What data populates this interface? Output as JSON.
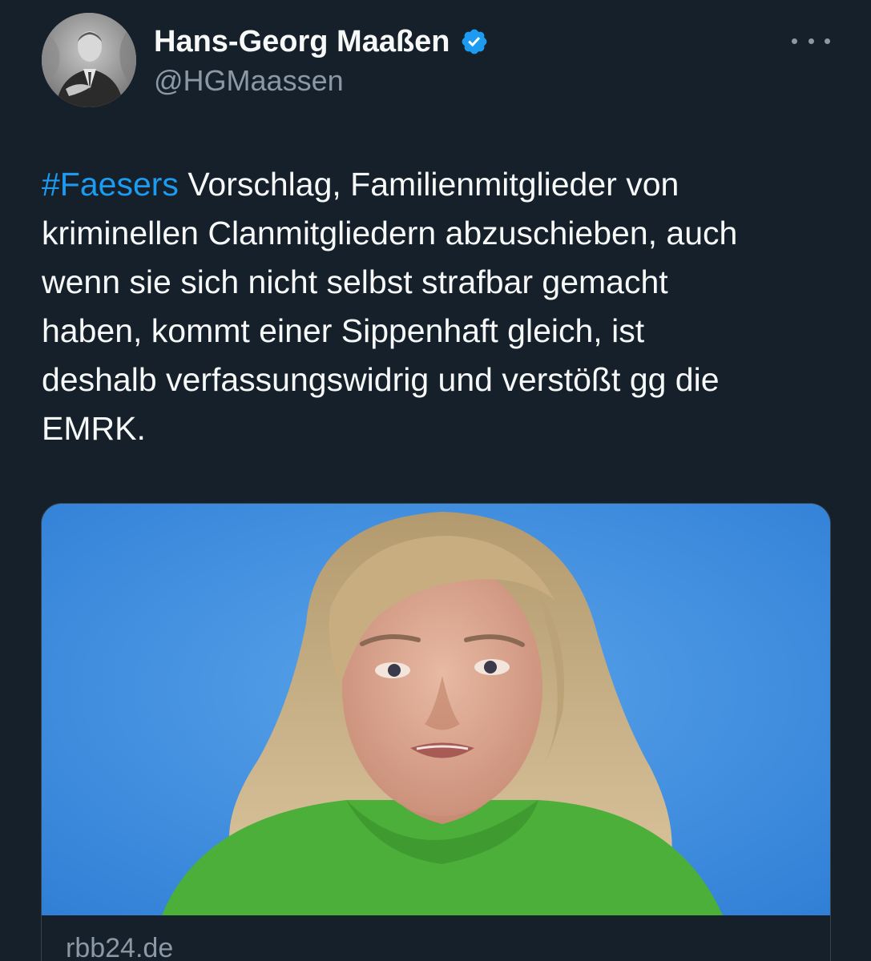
{
  "author": {
    "display_name": "Hans-Georg Maaßen",
    "handle": "@HGMaassen",
    "verified": true
  },
  "more_menu_icon": "more-horizontal-icon",
  "tweet": {
    "hashtag": "#Faesers",
    "line1_rest": " Vorschlag, Familienmitglieder von",
    "line2": "kriminellen Clanmitgliedern abzuschieben, auch",
    "line3": "wenn sie sich nicht selbst strafbar gemacht",
    "line4": "haben, kommt einer Sippenhaft gleich, ist",
    "line5": "deshalb verfassungswidrig und verstößt gg die",
    "line6": "EMRK."
  },
  "link_card": {
    "domain": "rbb24.de"
  },
  "colors": {
    "background": "#15202b",
    "text": "#f7f9f9",
    "secondary_text": "#8b98a5",
    "link": "#1d9bf0",
    "verified_badge": "#1d9bf0",
    "card_border": "#38444d"
  }
}
